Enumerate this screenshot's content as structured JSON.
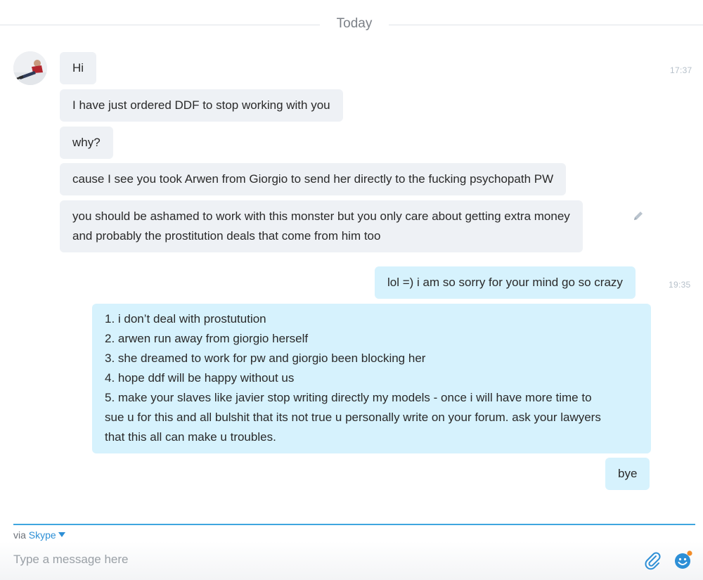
{
  "date_separator": "Today",
  "messages": [
    {
      "text": "Hi",
      "direction": "incoming"
    },
    {
      "text": "I have just ordered DDF to stop working with you",
      "direction": "incoming"
    },
    {
      "text": "why?",
      "direction": "incoming"
    },
    {
      "text": "cause I see you took Arwen from Giorgio to send her directly to the fucking psychopath PW",
      "direction": "incoming"
    },
    {
      "lines": [
        "you should be ashamed to work with this monster but you only care about getting extra money",
        "and probably the prostitution deals that come from him too"
      ],
      "direction": "incoming"
    },
    {
      "text": "lol =) i am so sorry for your mind go so crazy",
      "direction": "outgoing"
    },
    {
      "lines": [
        "1. i don’t deal with prostutution",
        "2. arwen run away from giorgio herself",
        "3. she dreamed to work for pw and giorgio been blocking her",
        "4. hope ddf will be happy without us",
        "5. make your slaves like javier stop writing directly my models - once i will have more time to",
        "sue u for this and all bulshit that its not true u personally write on your forum. ask your lawyers",
        "that this all can make u troubles."
      ],
      "direction": "outgoing"
    },
    {
      "text": "bye",
      "direction": "outgoing"
    }
  ],
  "timestamps": {
    "first": "17:37",
    "second": "19:35"
  },
  "composer": {
    "via_label": "via",
    "service_label": "Skype",
    "placeholder": "Type a message here"
  },
  "icons": {
    "edit": "pencil-icon",
    "attach": "paperclip-icon",
    "emoji": "smiley-icon",
    "dropdown": "caret-down-icon"
  },
  "colors": {
    "incoming_bubble": "#eef1f5",
    "outgoing_bubble": "#d6f2fd",
    "accent": "#2d8fd6",
    "notification_dot": "#f28c28"
  }
}
